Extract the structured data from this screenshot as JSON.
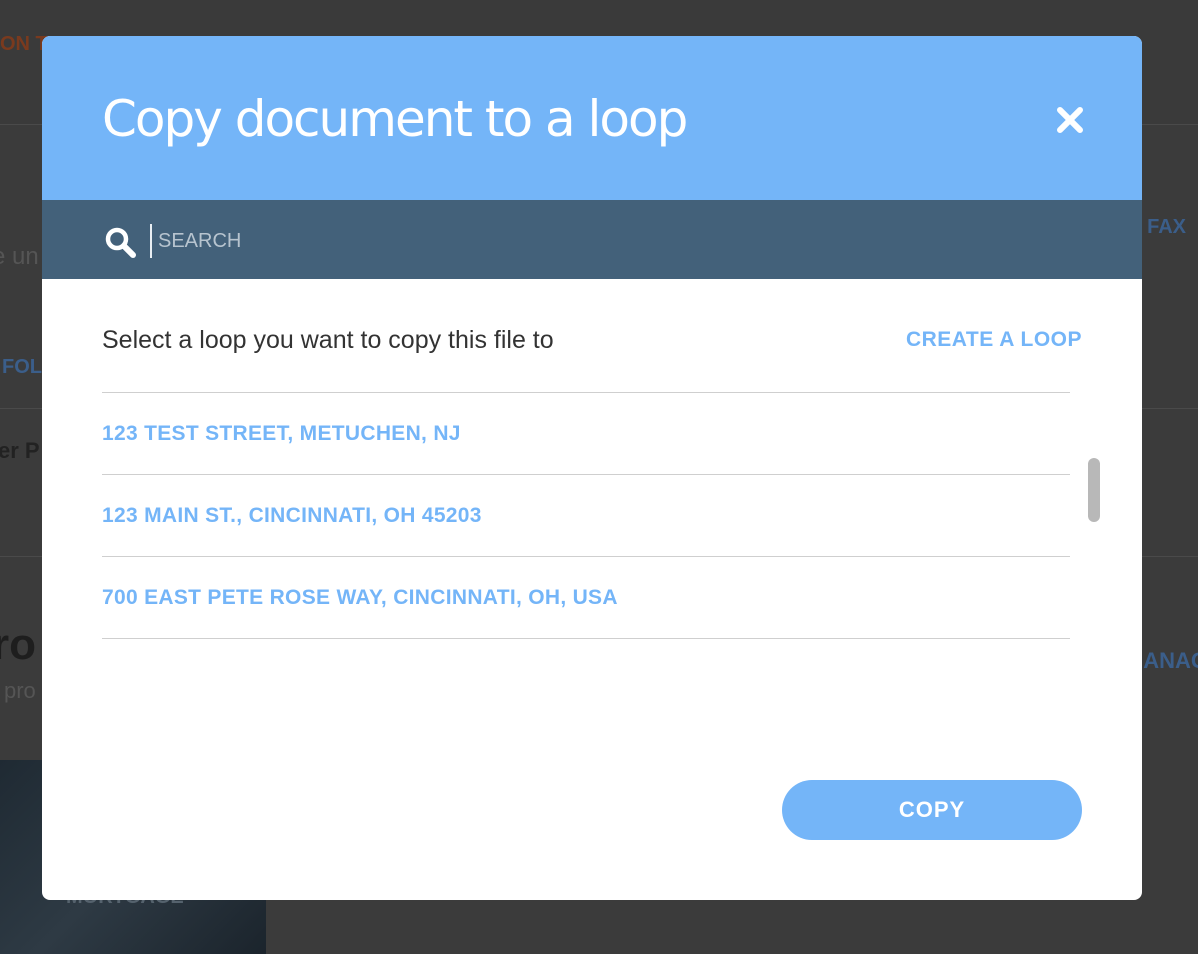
{
  "background": {
    "fragments": {
      "orange": "ON T",
      "fax": "FAX",
      "left_text": "e un",
      "fol": "FOL",
      "er": "er P",
      "ro": "ro",
      "pro": "pro",
      "anac": "ANAG",
      "photo_text": "MORTGAGE"
    }
  },
  "modal": {
    "title": "Copy document to a loop",
    "close_icon": "close-icon",
    "search": {
      "placeholder": "SEARCH",
      "value": "",
      "icon": "search-icon"
    },
    "instruction": "Select a loop you want to copy this file to",
    "create_link": "CREATE A LOOP",
    "loops": [
      {
        "label": "123 TEST STREET, METUCHEN, NJ"
      },
      {
        "label": "123 MAIN ST., CINCINNATI, OH 45203"
      },
      {
        "label": "700 EAST PETE ROSE WAY, CINCINNATI, OH, USA"
      }
    ],
    "copy_button": "COPY"
  },
  "colors": {
    "accent": "#74b5f8",
    "search_bar": "#43617a",
    "overlay": "#3b3b3b"
  }
}
